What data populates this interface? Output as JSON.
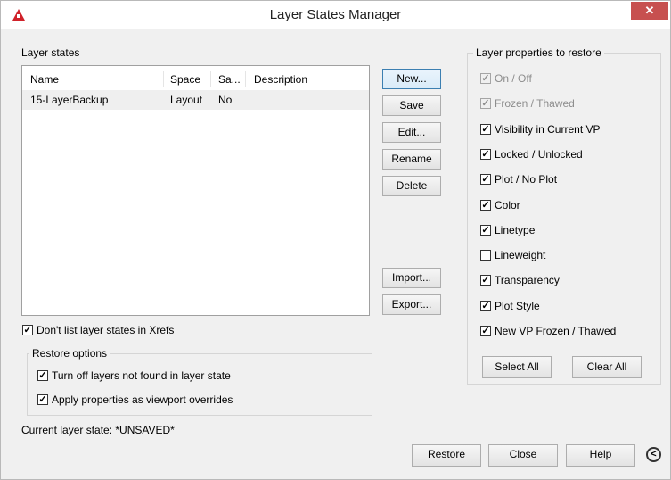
{
  "window": {
    "title": "Layer States Manager",
    "close_glyph": "✕",
    "icon": "autocad-logo-icon"
  },
  "layer_states": {
    "label": "Layer states",
    "columns": [
      "Name",
      "Space",
      "Sa...",
      "Description"
    ],
    "rows": [
      {
        "name": "15-LayerBackup",
        "space": "Layout",
        "saved": "No",
        "description": ""
      }
    ]
  },
  "buttons": {
    "new": "New...",
    "save": "Save",
    "edit": "Edit...",
    "rename": "Rename",
    "delete": "Delete",
    "import": "Import...",
    "export": "Export...",
    "select_all": "Select All",
    "clear_all": "Clear All",
    "restore": "Restore",
    "close": "Close",
    "help": "Help",
    "collapse_glyph": "<"
  },
  "dont_list_xrefs": {
    "label": "Don't list layer states in Xrefs",
    "checked": true
  },
  "restore_options": {
    "title": "Restore options",
    "turn_off_layers": {
      "label": "Turn off layers not found in layer state",
      "checked": true
    },
    "apply_overrides": {
      "label": "Apply properties as viewport overrides",
      "checked": true
    }
  },
  "current_state": "Current layer state: *UNSAVED*",
  "properties": {
    "title": "Layer properties to restore",
    "check_glyph": "✓",
    "items": [
      {
        "label": "On / Off",
        "checked": true,
        "disabled": true
      },
      {
        "label": "Frozen / Thawed",
        "checked": true,
        "disabled": true
      },
      {
        "label": "Visibility in Current VP",
        "checked": true,
        "disabled": false
      },
      {
        "label": "Locked / Unlocked",
        "checked": true,
        "disabled": false
      },
      {
        "label": "Plot / No Plot",
        "checked": true,
        "disabled": false
      },
      {
        "label": "Color",
        "checked": true,
        "disabled": false
      },
      {
        "label": "Linetype",
        "checked": true,
        "disabled": false
      },
      {
        "label": "Lineweight",
        "checked": false,
        "disabled": false
      },
      {
        "label": "Transparency",
        "checked": true,
        "disabled": false
      },
      {
        "label": "Plot Style",
        "checked": true,
        "disabled": false
      },
      {
        "label": "New VP Frozen / Thawed",
        "checked": true,
        "disabled": false
      }
    ]
  }
}
